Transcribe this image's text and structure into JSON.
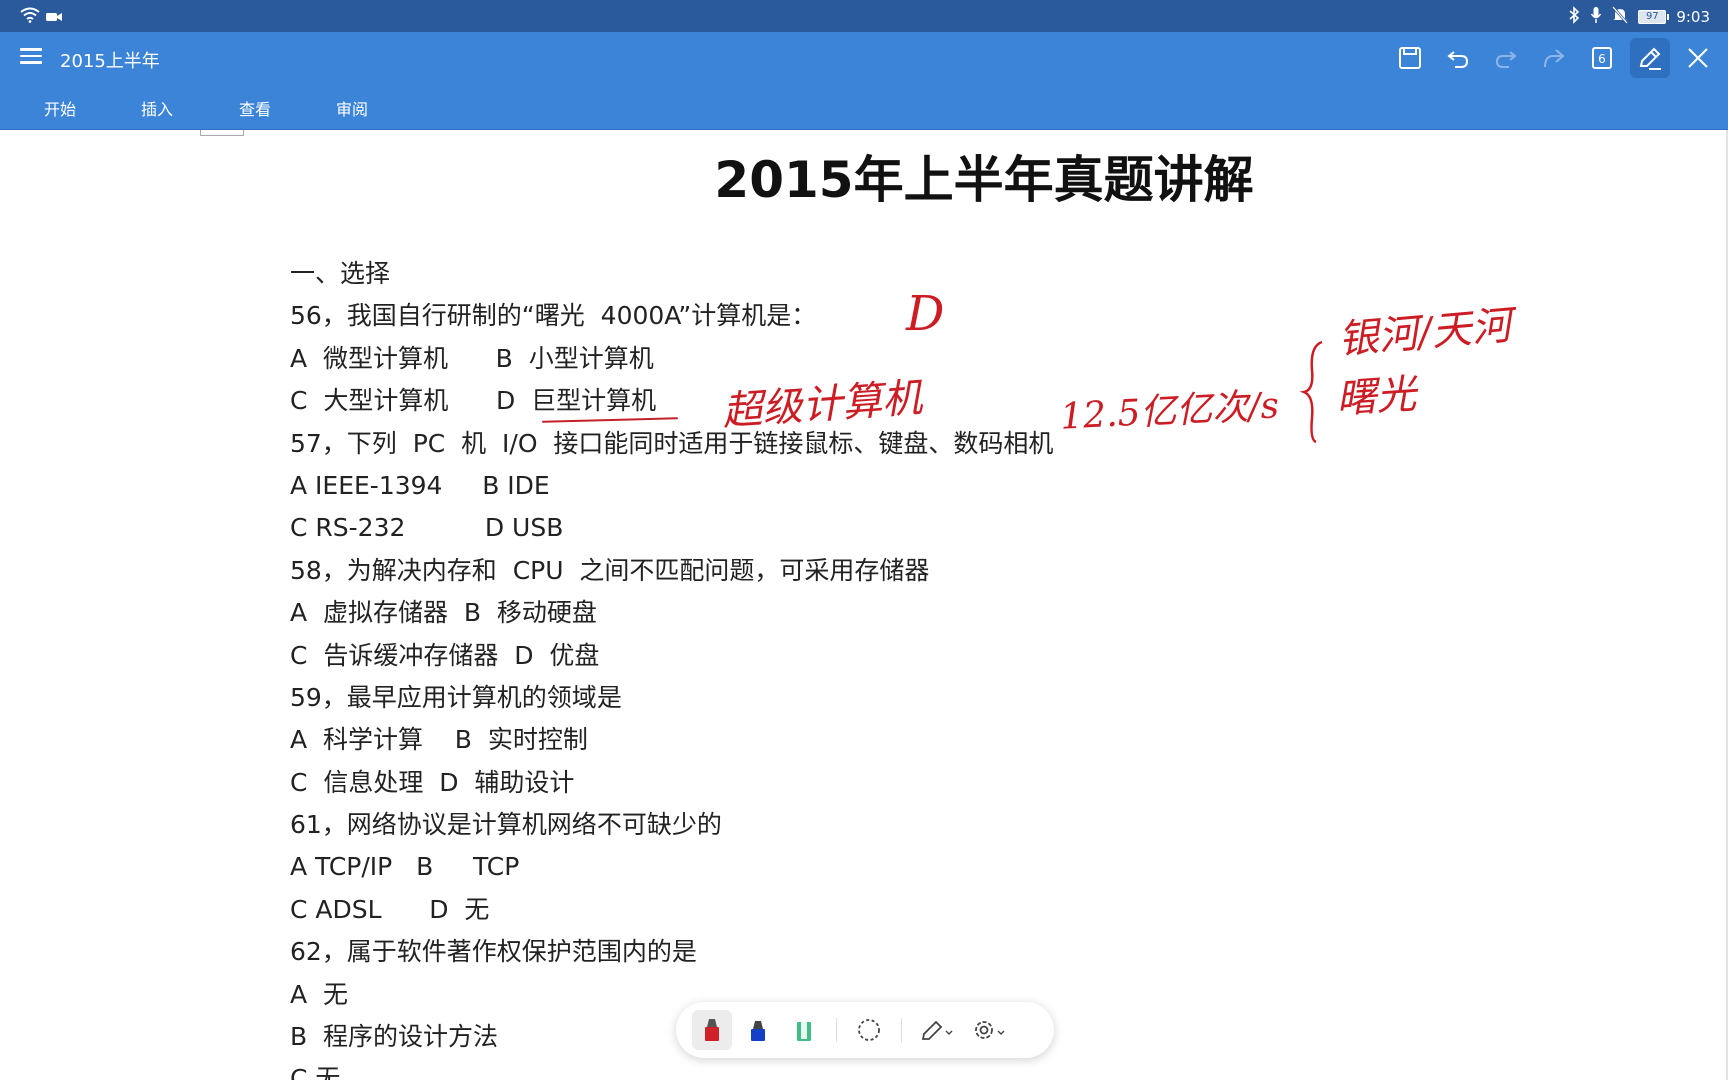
{
  "status_bar": {
    "battery": "97",
    "time": "9:03",
    "icons": [
      "wifi-icon",
      "camera-icon",
      "bluetooth-icon",
      "mic-icon",
      "bell-off-icon",
      "battery-icon"
    ]
  },
  "title_bar": {
    "doc_title": "2015上半年",
    "page_count": "6",
    "icons": [
      "menu-icon",
      "save-icon",
      "undo-icon",
      "redo-icon",
      "share-icon",
      "page-count-icon",
      "pen-mode-icon",
      "close-icon"
    ]
  },
  "ribbon": {
    "tabs": [
      {
        "label": "开始"
      },
      {
        "label": "插入"
      },
      {
        "label": "查看"
      },
      {
        "label": "审阅"
      }
    ]
  },
  "document": {
    "heading": "2015年上半年真题讲解",
    "lines": [
      "一、选择",
      "56，我国自行研制的“曙光  4000A”计算机是：",
      "A  微型计算机      B  小型计算机",
      "C  大型计算机      D  巨型计算机",
      "57，下列  PC  机  I/O  接口能同时适用于链接鼠标、键盘、数码相机",
      "A IEEE-1394     B IDE",
      "C RS-232          D USB",
      "58，为解决内存和  CPU  之间不匹配问题，可采用存储器",
      "A  虚拟存储器  B  移动硬盘",
      "C  告诉缓冲存储器  D  优盘",
      "59，最早应用计算机的领域是",
      "A  科学计算    B  实时控制",
      "C  信息处理  D  辅助设计",
      "61，网络协议是计算机网络不可缺少的",
      "A TCP/IP   B     TCP",
      "C ADSL      D  无",
      "62，属于软件著作权保护范围内的是",
      "A  无",
      "B  程序的设计方法",
      "C 无"
    ]
  },
  "annotations": {
    "answer": "D",
    "note_super": "超级计算机",
    "note_speed": "12.5亿亿次/s",
    "note_list_1": "银河/天河",
    "note_list_2": "曙光",
    "ink_color": "#cc1d24"
  },
  "pen_toolbar": {
    "tools": [
      "red-pen-icon",
      "blue-pen-icon",
      "highlighter-icon",
      "lasso-icon",
      "pen-style-icon",
      "settings-icon"
    ]
  },
  "colors": {
    "status_bar": "#2a5a9c",
    "title_bar": "#3b84d8"
  }
}
